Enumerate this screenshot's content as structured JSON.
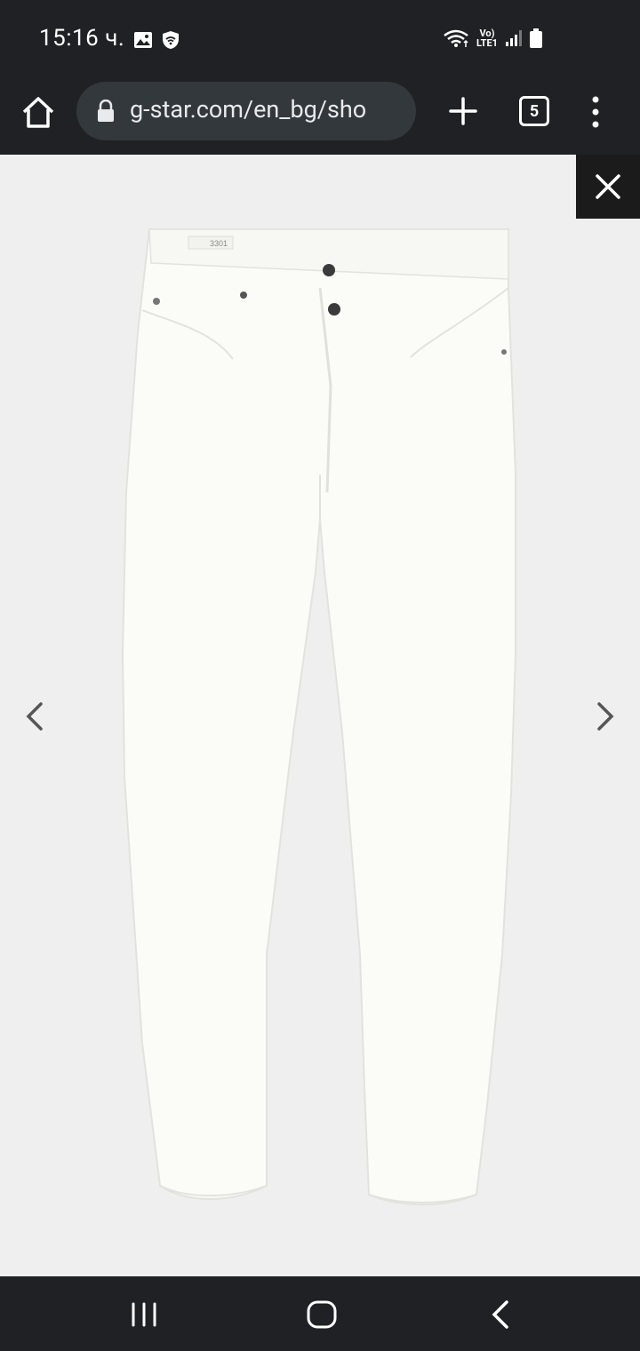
{
  "status_bar": {
    "time": "15:16 ч.",
    "network_label_top": "Vo)",
    "network_label_bottom": "LTE1"
  },
  "browser": {
    "url": "g-star.com/en_bg/sho",
    "tab_count": "5"
  },
  "product_image": {
    "description_icon": "white-jeans-image",
    "label_text": "3301"
  },
  "colors": {
    "chrome_bg": "#1f2124",
    "url_bar_bg": "#33383d",
    "viewer_bg": "#efefef",
    "close_bg": "#1b1b1b"
  }
}
